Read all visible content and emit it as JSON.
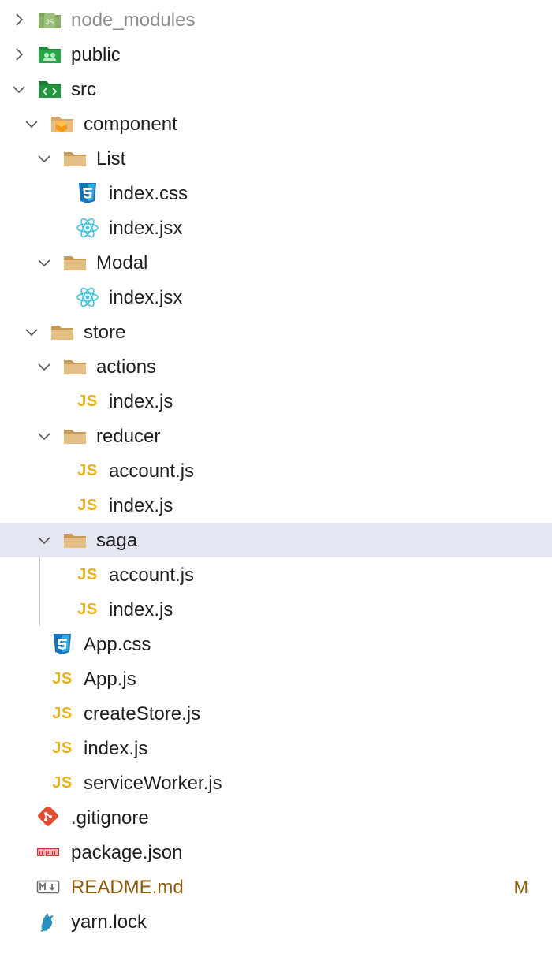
{
  "explorer": {
    "items": [
      {
        "label": "node_modules",
        "kind": "folder",
        "icon": "node-folder-icon",
        "expanded": false
      },
      {
        "label": "public",
        "kind": "folder",
        "icon": "public-folder-icon",
        "expanded": false
      },
      {
        "label": "src",
        "kind": "folder",
        "icon": "src-folder-icon",
        "expanded": true
      },
      {
        "label": "component",
        "kind": "folder",
        "icon": "component-folder-icon",
        "expanded": true
      },
      {
        "label": "List",
        "kind": "folder",
        "icon": "folder-icon",
        "expanded": true
      },
      {
        "label": "index.css",
        "kind": "file",
        "icon": "css-icon"
      },
      {
        "label": "index.jsx",
        "kind": "file",
        "icon": "react-icon"
      },
      {
        "label": "Modal",
        "kind": "folder",
        "icon": "folder-icon",
        "expanded": true
      },
      {
        "label": "index.jsx",
        "kind": "file",
        "icon": "react-icon"
      },
      {
        "label": "store",
        "kind": "folder",
        "icon": "folder-icon",
        "expanded": true
      },
      {
        "label": "actions",
        "kind": "folder",
        "icon": "folder-icon",
        "expanded": true
      },
      {
        "label": "index.js",
        "kind": "file",
        "icon": "js-icon"
      },
      {
        "label": "reducer",
        "kind": "folder",
        "icon": "folder-icon",
        "expanded": true
      },
      {
        "label": "account.js",
        "kind": "file",
        "icon": "js-icon"
      },
      {
        "label": "index.js",
        "kind": "file",
        "icon": "js-icon"
      },
      {
        "label": "saga",
        "kind": "folder",
        "icon": "folder-icon",
        "expanded": true,
        "selected": true
      },
      {
        "label": "account.js",
        "kind": "file",
        "icon": "js-icon"
      },
      {
        "label": "index.js",
        "kind": "file",
        "icon": "js-icon"
      },
      {
        "label": "App.css",
        "kind": "file",
        "icon": "css-icon"
      },
      {
        "label": "App.js",
        "kind": "file",
        "icon": "js-icon"
      },
      {
        "label": "createStore.js",
        "kind": "file",
        "icon": "js-icon"
      },
      {
        "label": "index.js",
        "kind": "file",
        "icon": "js-icon"
      },
      {
        "label": "serviceWorker.js",
        "kind": "file",
        "icon": "js-icon"
      },
      {
        "label": ".gitignore",
        "kind": "file",
        "icon": "git-icon"
      },
      {
        "label": "package.json",
        "kind": "file",
        "icon": "npm-icon"
      },
      {
        "label": "README.md",
        "kind": "file",
        "icon": "markdown-icon",
        "status": "M"
      },
      {
        "label": "yarn.lock",
        "kind": "file",
        "icon": "yarn-icon"
      }
    ],
    "js_glyph": "JS",
    "colors": {
      "selected_row": "#e4e6f1",
      "modified_text": "#8c5a0a",
      "js_yellow": "#e6b019",
      "css_blue": "#1572b6",
      "react_cyan": "#3cc4dc",
      "folder_tan": "#dcb67a",
      "git_red": "#e24e32",
      "npm_red": "#cb3837",
      "yarn_blue": "#2c8ebb"
    }
  }
}
